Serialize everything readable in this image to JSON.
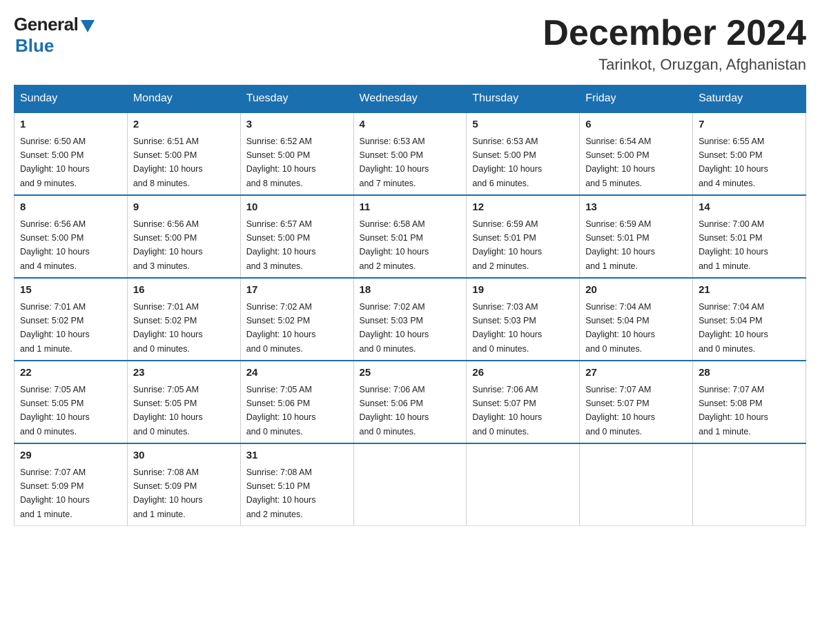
{
  "logo": {
    "general": "General",
    "blue": "Blue"
  },
  "title": {
    "month_year": "December 2024",
    "location": "Tarinkot, Oruzgan, Afghanistan"
  },
  "days_of_week": [
    "Sunday",
    "Monday",
    "Tuesday",
    "Wednesday",
    "Thursday",
    "Friday",
    "Saturday"
  ],
  "weeks": [
    [
      {
        "day": "1",
        "sunrise": "6:50 AM",
        "sunset": "5:00 PM",
        "daylight": "10 hours and 9 minutes."
      },
      {
        "day": "2",
        "sunrise": "6:51 AM",
        "sunset": "5:00 PM",
        "daylight": "10 hours and 8 minutes."
      },
      {
        "day": "3",
        "sunrise": "6:52 AM",
        "sunset": "5:00 PM",
        "daylight": "10 hours and 8 minutes."
      },
      {
        "day": "4",
        "sunrise": "6:53 AM",
        "sunset": "5:00 PM",
        "daylight": "10 hours and 7 minutes."
      },
      {
        "day": "5",
        "sunrise": "6:53 AM",
        "sunset": "5:00 PM",
        "daylight": "10 hours and 6 minutes."
      },
      {
        "day": "6",
        "sunrise": "6:54 AM",
        "sunset": "5:00 PM",
        "daylight": "10 hours and 5 minutes."
      },
      {
        "day": "7",
        "sunrise": "6:55 AM",
        "sunset": "5:00 PM",
        "daylight": "10 hours and 4 minutes."
      }
    ],
    [
      {
        "day": "8",
        "sunrise": "6:56 AM",
        "sunset": "5:00 PM",
        "daylight": "10 hours and 4 minutes."
      },
      {
        "day": "9",
        "sunrise": "6:56 AM",
        "sunset": "5:00 PM",
        "daylight": "10 hours and 3 minutes."
      },
      {
        "day": "10",
        "sunrise": "6:57 AM",
        "sunset": "5:00 PM",
        "daylight": "10 hours and 3 minutes."
      },
      {
        "day": "11",
        "sunrise": "6:58 AM",
        "sunset": "5:01 PM",
        "daylight": "10 hours and 2 minutes."
      },
      {
        "day": "12",
        "sunrise": "6:59 AM",
        "sunset": "5:01 PM",
        "daylight": "10 hours and 2 minutes."
      },
      {
        "day": "13",
        "sunrise": "6:59 AM",
        "sunset": "5:01 PM",
        "daylight": "10 hours and 1 minute."
      },
      {
        "day": "14",
        "sunrise": "7:00 AM",
        "sunset": "5:01 PM",
        "daylight": "10 hours and 1 minute."
      }
    ],
    [
      {
        "day": "15",
        "sunrise": "7:01 AM",
        "sunset": "5:02 PM",
        "daylight": "10 hours and 1 minute."
      },
      {
        "day": "16",
        "sunrise": "7:01 AM",
        "sunset": "5:02 PM",
        "daylight": "10 hours and 0 minutes."
      },
      {
        "day": "17",
        "sunrise": "7:02 AM",
        "sunset": "5:02 PM",
        "daylight": "10 hours and 0 minutes."
      },
      {
        "day": "18",
        "sunrise": "7:02 AM",
        "sunset": "5:03 PM",
        "daylight": "10 hours and 0 minutes."
      },
      {
        "day": "19",
        "sunrise": "7:03 AM",
        "sunset": "5:03 PM",
        "daylight": "10 hours and 0 minutes."
      },
      {
        "day": "20",
        "sunrise": "7:04 AM",
        "sunset": "5:04 PM",
        "daylight": "10 hours and 0 minutes."
      },
      {
        "day": "21",
        "sunrise": "7:04 AM",
        "sunset": "5:04 PM",
        "daylight": "10 hours and 0 minutes."
      }
    ],
    [
      {
        "day": "22",
        "sunrise": "7:05 AM",
        "sunset": "5:05 PM",
        "daylight": "10 hours and 0 minutes."
      },
      {
        "day": "23",
        "sunrise": "7:05 AM",
        "sunset": "5:05 PM",
        "daylight": "10 hours and 0 minutes."
      },
      {
        "day": "24",
        "sunrise": "7:05 AM",
        "sunset": "5:06 PM",
        "daylight": "10 hours and 0 minutes."
      },
      {
        "day": "25",
        "sunrise": "7:06 AM",
        "sunset": "5:06 PM",
        "daylight": "10 hours and 0 minutes."
      },
      {
        "day": "26",
        "sunrise": "7:06 AM",
        "sunset": "5:07 PM",
        "daylight": "10 hours and 0 minutes."
      },
      {
        "day": "27",
        "sunrise": "7:07 AM",
        "sunset": "5:07 PM",
        "daylight": "10 hours and 0 minutes."
      },
      {
        "day": "28",
        "sunrise": "7:07 AM",
        "sunset": "5:08 PM",
        "daylight": "10 hours and 1 minute."
      }
    ],
    [
      {
        "day": "29",
        "sunrise": "7:07 AM",
        "sunset": "5:09 PM",
        "daylight": "10 hours and 1 minute."
      },
      {
        "day": "30",
        "sunrise": "7:08 AM",
        "sunset": "5:09 PM",
        "daylight": "10 hours and 1 minute."
      },
      {
        "day": "31",
        "sunrise": "7:08 AM",
        "sunset": "5:10 PM",
        "daylight": "10 hours and 2 minutes."
      },
      null,
      null,
      null,
      null
    ]
  ],
  "labels": {
    "sunrise": "Sunrise:",
    "sunset": "Sunset:",
    "daylight": "Daylight:"
  }
}
